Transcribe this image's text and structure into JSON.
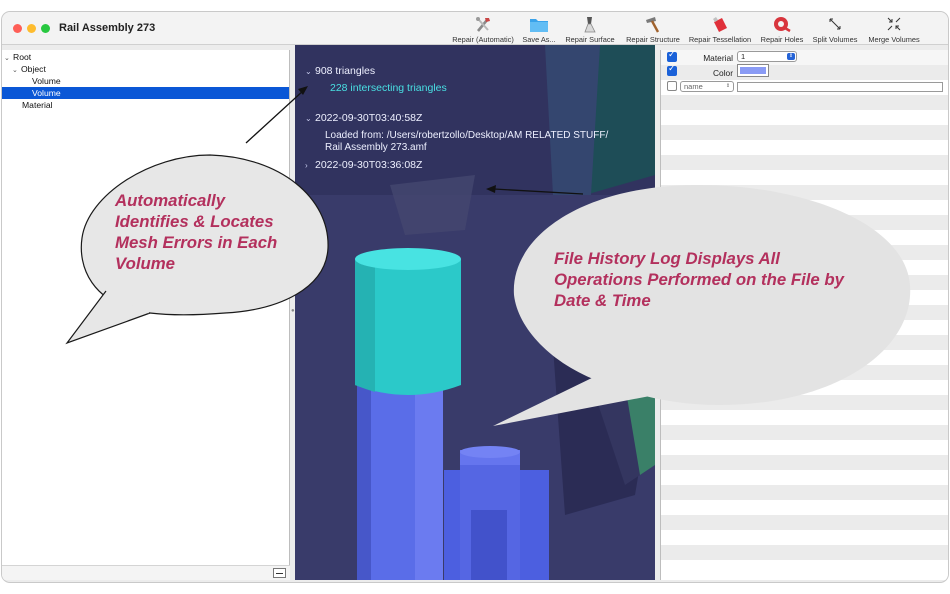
{
  "window": {
    "title": "Rail Assembly 273"
  },
  "toolbar": {
    "items": [
      {
        "label": "Repair (Automatic)",
        "icon": "wrench-hammer-icon"
      },
      {
        "label": "Save As...",
        "icon": "folder-icon"
      },
      {
        "label": "Repair Surface",
        "icon": "brush-icon"
      },
      {
        "label": "Repair Structure",
        "icon": "hammer-icon"
      },
      {
        "label": "Repair Tessellation",
        "icon": "glue-bottle-icon"
      },
      {
        "label": "Repair Holes",
        "icon": "tape-roll-icon"
      },
      {
        "label": "Split Volumes",
        "icon": "split-arrows-icon"
      },
      {
        "label": "Merge Volumes",
        "icon": "merge-arrows-icon"
      }
    ]
  },
  "tree": {
    "items": [
      {
        "label": "Root",
        "expanded": true
      },
      {
        "label": "Object",
        "expanded": true
      },
      {
        "label": "Volume"
      },
      {
        "label": "Volume",
        "selected": true
      },
      {
        "label": "Material"
      }
    ]
  },
  "log": {
    "triangles": "908 triangles",
    "intersecting": "228 intersecting triangles",
    "entry1_time": "2022-09-30T03:40:58Z",
    "entry1_detail_line1": "Loaded from: /Users/robertzollo/Desktop/AM RELATED STUFF/",
    "entry1_detail_line2": "Rail Assembly 273.amf",
    "entry2_time": "2022-09-30T03:36:08Z"
  },
  "properties": {
    "material_label": "Material",
    "material_value": "1",
    "material_checked": true,
    "color_label": "Color",
    "color_value": "#8a9bf5",
    "color_checked": true,
    "name_placeholder": "name",
    "name_checked": false
  },
  "callouts": {
    "left": [
      "Automatically",
      "Identifies & Locates",
      "Mesh Errors in Each",
      "Volume"
    ],
    "right": [
      "File History Log Displays All",
      "Operations Performed on the File by",
      "Date & Time"
    ]
  },
  "colors": {
    "accent": "#0a57d6",
    "callout_text": "#b3305d",
    "intersect_text": "#49e0e3",
    "cylinder_top": "#22d4d2",
    "cylinder_body": "#5b6fe6"
  }
}
